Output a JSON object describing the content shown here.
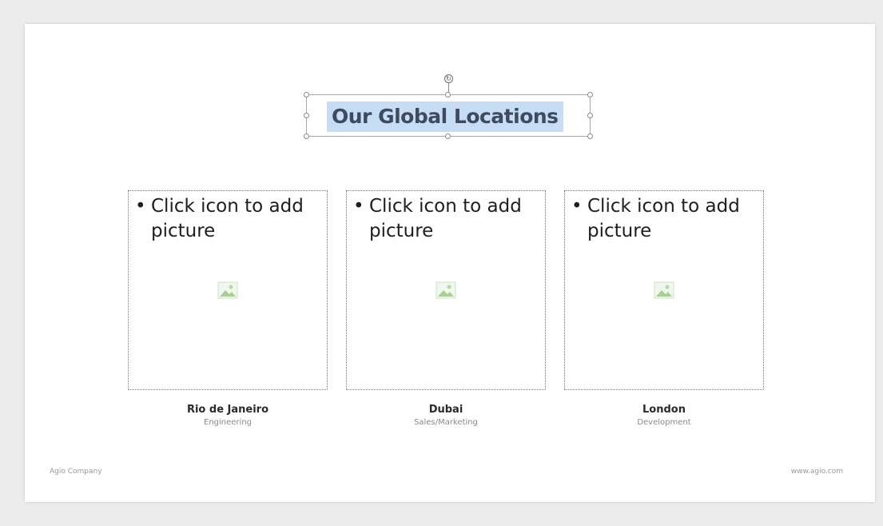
{
  "slide": {
    "title": "Our Global Locations",
    "placeholders": [
      {
        "line1": "Click icon to add",
        "line2": "picture",
        "icon": "picture-icon",
        "city": "Rio de Janeiro",
        "department": "Engineering"
      },
      {
        "line1": "Click icon to add",
        "line2": "picture",
        "icon": "picture-icon",
        "city": "Dubai",
        "department": "Sales/Marketing"
      },
      {
        "line1": "Click icon to add",
        "line2": "picture",
        "icon": "picture-icon",
        "city": "London",
        "department": "Development"
      }
    ],
    "footer_left": "Agio Company",
    "footer_right": "www.agio.com"
  },
  "colors": {
    "title_text": "#3e4b5e",
    "title_highlight": "#c7ddf6",
    "background": "#ececec",
    "slide": "#ffffff"
  }
}
